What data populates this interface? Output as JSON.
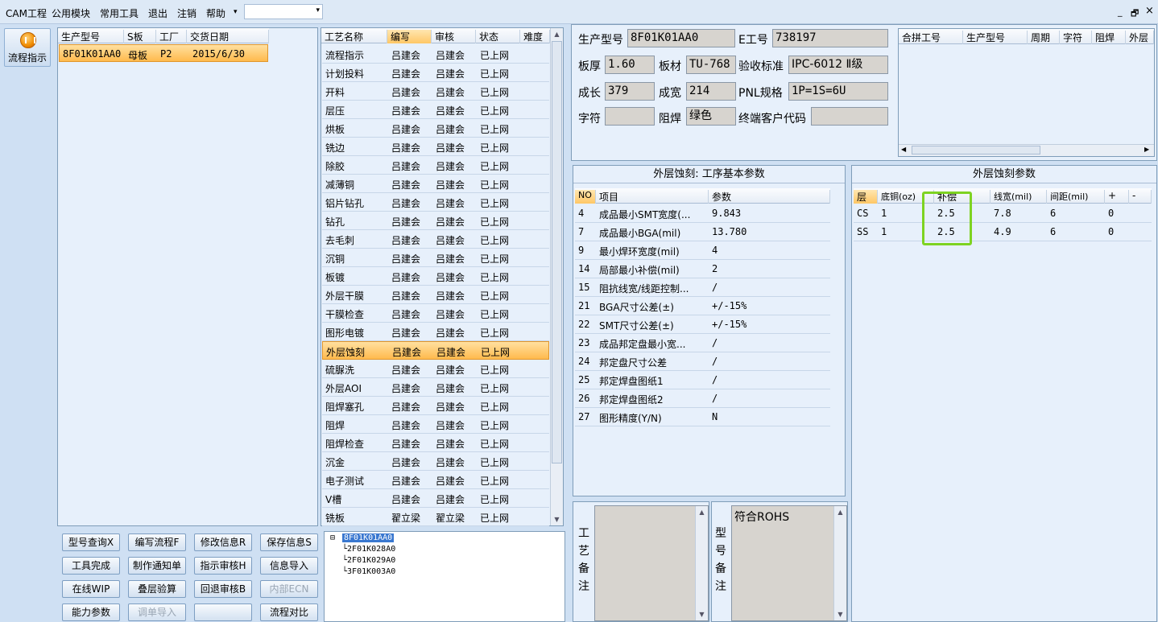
{
  "menu": {
    "items": [
      "CAM工程",
      "公用模块",
      "常用工具",
      "退出",
      "注销",
      "帮助"
    ],
    "combo_value": ""
  },
  "window_controls": {
    "minimize": "_",
    "restore": "🗗",
    "close": "×"
  },
  "sidebar": {
    "button_label": "流程指示",
    "icon": "process-icon"
  },
  "order_list": {
    "headers": [
      "生产型号",
      "S板",
      "工厂",
      "交货日期"
    ],
    "rows": [
      [
        "8F01K01AA0",
        "母板",
        "P2",
        "2015/6/30"
      ]
    ]
  },
  "process_list": {
    "headers": [
      "工艺名称",
      "编写",
      "审核",
      "状态",
      "难度"
    ],
    "rows": [
      [
        "流程指示",
        "吕建会",
        "吕建会",
        "已上网"
      ],
      [
        "计划投料",
        "吕建会",
        "吕建会",
        "已上网"
      ],
      [
        "开料",
        "吕建会",
        "吕建会",
        "已上网"
      ],
      [
        "层压",
        "吕建会",
        "吕建会",
        "已上网"
      ],
      [
        "烘板",
        "吕建会",
        "吕建会",
        "已上网"
      ],
      [
        "铣边",
        "吕建会",
        "吕建会",
        "已上网"
      ],
      [
        "除胶",
        "吕建会",
        "吕建会",
        "已上网"
      ],
      [
        "减薄铜",
        "吕建会",
        "吕建会",
        "已上网"
      ],
      [
        "铝片钻孔",
        "吕建会",
        "吕建会",
        "已上网"
      ],
      [
        "钻孔",
        "吕建会",
        "吕建会",
        "已上网"
      ],
      [
        "去毛刺",
        "吕建会",
        "吕建会",
        "已上网"
      ],
      [
        "沉铜",
        "吕建会",
        "吕建会",
        "已上网"
      ],
      [
        "板镀",
        "吕建会",
        "吕建会",
        "已上网"
      ],
      [
        "外层干膜",
        "吕建会",
        "吕建会",
        "已上网"
      ],
      [
        "干膜检查",
        "吕建会",
        "吕建会",
        "已上网"
      ],
      [
        "图形电镀",
        "吕建会",
        "吕建会",
        "已上网"
      ],
      [
        "外层蚀刻",
        "吕建会",
        "吕建会",
        "已上网"
      ],
      [
        "硫脲洗",
        "吕建会",
        "吕建会",
        "已上网"
      ],
      [
        "外层AOI",
        "吕建会",
        "吕建会",
        "已上网"
      ],
      [
        "阻焊塞孔",
        "吕建会",
        "吕建会",
        "已上网"
      ],
      [
        "阻焊",
        "吕建会",
        "吕建会",
        "已上网"
      ],
      [
        "阻焊检查",
        "吕建会",
        "吕建会",
        "已上网"
      ],
      [
        "沉金",
        "吕建会",
        "吕建会",
        "已上网"
      ],
      [
        "电子测试",
        "吕建会",
        "吕建会",
        "已上网"
      ],
      [
        "V槽",
        "吕建会",
        "吕建会",
        "已上网"
      ],
      [
        "铣板",
        "翟立梁",
        "翟立梁",
        "已上网"
      ]
    ],
    "selected": "外层蚀刻"
  },
  "buttons": [
    [
      "型号查询X",
      "编写流程F",
      "修改信息R",
      "保存信息S"
    ],
    [
      "工具完成",
      "制作通知单",
      "指示审核H",
      "信息导入"
    ],
    [
      "在线WIP",
      "叠层验算",
      "回退审核B",
      "内部ECN"
    ],
    [
      "能力参数",
      "调单导入",
      "",
      "流程对比"
    ]
  ],
  "tree": {
    "root": "8F01K01AA0",
    "children": [
      "2F01K028A0",
      "2F01K029A0",
      "3F01K003A0"
    ]
  },
  "info": {
    "labels": {
      "model": "生产型号",
      "eno": "E工号",
      "thickness": "板厚",
      "material": "板材",
      "standard": "验收标准",
      "length": "成长",
      "width": "成宽",
      "pnl": "PNL规格",
      "legend": "字符",
      "mask": "阻焊",
      "customer": "终端客户代码"
    },
    "values": {
      "model": "8F01K01AA0",
      "eno": "738197",
      "thickness": "1.60",
      "material": "TU-768",
      "standard": "IPC-6012 Ⅱ级",
      "length": "379",
      "width": "214",
      "pnl": "1P=1S=6U",
      "legend": "",
      "mask": "绿色",
      "customer": ""
    }
  },
  "combine_list": {
    "headers": [
      "合拼工号",
      "生产型号",
      "周期",
      "字符",
      "阻焊",
      "外层"
    ]
  },
  "basic_params": {
    "title": "外层蚀刻: 工序基本参数",
    "headers": [
      "NO",
      "项目",
      "参数"
    ],
    "rows": [
      [
        "4",
        "成品最小SMT宽度(...",
        "9.843"
      ],
      [
        "7",
        "成品最小BGA(mil)",
        "13.780"
      ],
      [
        "9",
        "最小焊环宽度(mil)",
        "4"
      ],
      [
        "14",
        "局部最小补偿(mil)",
        "2"
      ],
      [
        "15",
        "阻抗线宽/线距控制...",
        "/"
      ],
      [
        "21",
        "BGA尺寸公差(±)",
        "+/-15%"
      ],
      [
        "22",
        "SMT尺寸公差(±)",
        "+/-15%"
      ],
      [
        "23",
        "成品邦定盘最小宽...",
        "/"
      ],
      [
        "24",
        "邦定盘尺寸公差",
        "/"
      ],
      [
        "25",
        "邦定焊盘图纸1",
        "/"
      ],
      [
        "26",
        "邦定焊盘图纸2",
        "/"
      ],
      [
        "27",
        "图形精度(Y/N)",
        "N"
      ]
    ]
  },
  "etch_params": {
    "title": "外层蚀刻参数",
    "headers": [
      "层",
      "底铜(oz)",
      "补偿",
      "线宽(mil)",
      "间距(mil)",
      "+",
      "-"
    ],
    "rows": [
      [
        "CS",
        "1",
        "2.5",
        "7.8",
        "6",
        "0",
        ""
      ],
      [
        "SS",
        "1",
        "2.5",
        "4.9",
        "6",
        "0",
        ""
      ]
    ]
  },
  "notes": {
    "process_label": "工艺备注",
    "process_text": "",
    "model_label": "型号备注",
    "model_text": "符合ROHS"
  },
  "colors": {
    "highlight": "#7ed321",
    "selection": "#ffc766",
    "accent": "#f08c00"
  }
}
